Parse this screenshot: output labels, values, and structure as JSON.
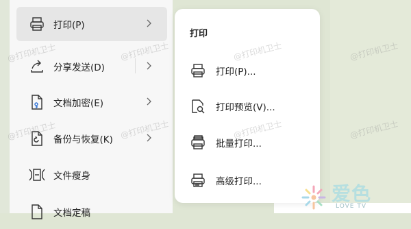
{
  "left_menu": {
    "items": [
      {
        "label": "打印(P)",
        "icon": "printer-icon",
        "active": true,
        "has_submenu": true
      },
      {
        "label": "分享发送(D)",
        "icon": "share-icon",
        "active": false,
        "has_submenu": true
      },
      {
        "label": "文档加密(E)",
        "icon": "document-lock-icon",
        "active": false,
        "has_submenu": true
      },
      {
        "label": "备份与恢复(K)",
        "icon": "backup-icon",
        "active": false,
        "has_submenu": true
      },
      {
        "label": "文件瘦身",
        "icon": "file-slim-icon",
        "active": false,
        "has_submenu": false
      },
      {
        "label": "文档定稿",
        "icon": "document-finalize-icon",
        "active": false,
        "has_submenu": false
      }
    ]
  },
  "submenu": {
    "title": "打印",
    "items": [
      {
        "label": "打印(P)...",
        "icon": "printer-icon"
      },
      {
        "label": "打印预览(V)...",
        "icon": "print-preview-icon"
      },
      {
        "label": "批量打印...",
        "icon": "batch-print-icon"
      },
      {
        "label": "高级打印...",
        "icon": "advanced-print-icon"
      }
    ]
  },
  "watermark": {
    "text": "@打印机卫士"
  },
  "logo": {
    "brand": "爱色",
    "sub": "LOVE TV"
  },
  "colors": {
    "active_bg": "#e6e6e6",
    "menu_bg": "#f7f7f7",
    "page_bg": "#dfe6d4",
    "brand": "#b6dfe0"
  }
}
